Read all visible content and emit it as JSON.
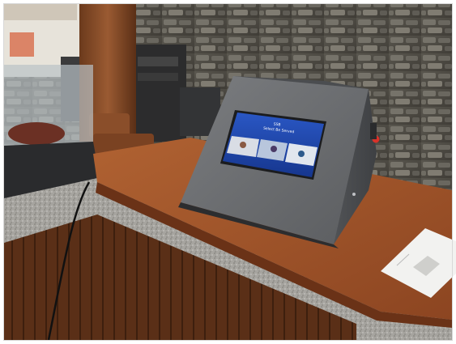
{
  "photo": {
    "subject": "kiosk-on-bar-counter",
    "kiosk_screen": {
      "title_line_1": "SSB",
      "title_line_2": "Select Be Served",
      "accent_color": "#1b3f9c"
    },
    "kiosk_button_color": "#d8322a"
  }
}
